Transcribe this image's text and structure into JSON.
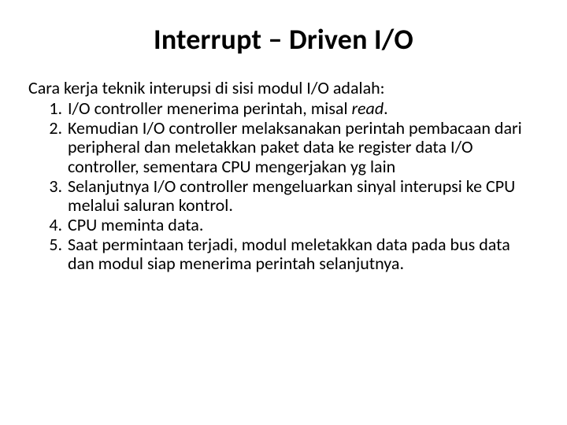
{
  "title": "Interrupt – Driven I/O",
  "intro": "Cara kerja teknik interupsi di sisi modul I/O adalah:",
  "items": {
    "i1a": "I/O controller menerima perintah, misal ",
    "i1b": "read",
    "i1c": ".",
    "i2": "Kemudian I/O controller melaksanakan perintah pembacaan dari peripheral dan meletakkan paket data ke register data I/O controller, sementara CPU mengerjakan yg lain",
    "i3": "Selanjutnya I/O controller mengeluarkan sinyal interupsi ke CPU melalui saluran kontrol.",
    "i4": "CPU meminta data.",
    "i5": "Saat permintaan terjadi, modul meletakkan data pada bus data dan modul siap menerima perintah selanjutnya."
  }
}
